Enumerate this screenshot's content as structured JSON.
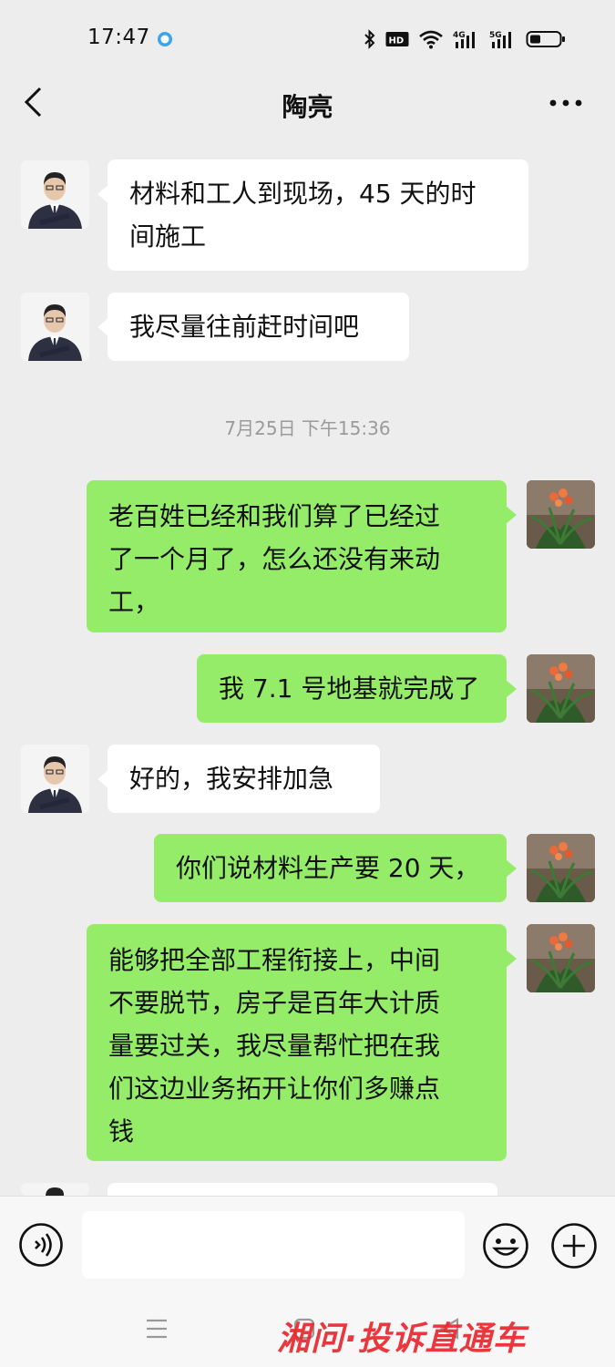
{
  "status_bar": {
    "time": "17:47",
    "hd_badge": "HD",
    "network_4g": "4G",
    "network_5g": "5G"
  },
  "header": {
    "back_icon": "chevron-left-icon",
    "title": "陶亮",
    "more_icon": "more-dots-icon"
  },
  "messages": [
    {
      "side": "in",
      "avatar": "man-avatar",
      "lines": [
        "材料和工人到现场，45 天的时",
        "间施工"
      ]
    },
    {
      "side": "in",
      "avatar": "man-avatar",
      "lines": [
        "我尽量往前赶时间吧"
      ]
    },
    {
      "side": "out",
      "avatar": "flower-avatar",
      "lines": [
        "老百姓已经和我们算了已经过",
        "了一个月了，怎么还没有来动",
        "工，"
      ]
    },
    {
      "side": "out",
      "avatar": "flower-avatar",
      "lines": [
        "我 7.1 号地基就完成了"
      ]
    },
    {
      "side": "in",
      "avatar": "man-avatar",
      "lines": [
        "好的，我安排加急"
      ]
    },
    {
      "side": "out",
      "avatar": "flower-avatar",
      "lines": [
        "你们说材料生产要 20 天，"
      ]
    },
    {
      "side": "out",
      "avatar": "flower-avatar",
      "lines": [
        "能够把全部工程衔接上，中间",
        "不要脱节，房子是百年大计质",
        "量要过关，我尽量帮忙把在我",
        "们这边业务拓开让你们多赚点",
        "钱"
      ]
    }
  ],
  "timestamp": "7月25日 下午15:36",
  "input_bar": {
    "voice_icon": "voice-icon",
    "input_value": "",
    "emoji_icon": "emoji-icon",
    "plus_icon": "plus-icon"
  },
  "bottom_nav": {
    "watermark": "湘问·投诉直通车"
  },
  "colors": {
    "background": "#ededed",
    "outgoing_bubble": "#95ec69",
    "incoming_bubble": "#ffffff",
    "watermark": "#e8232a"
  }
}
